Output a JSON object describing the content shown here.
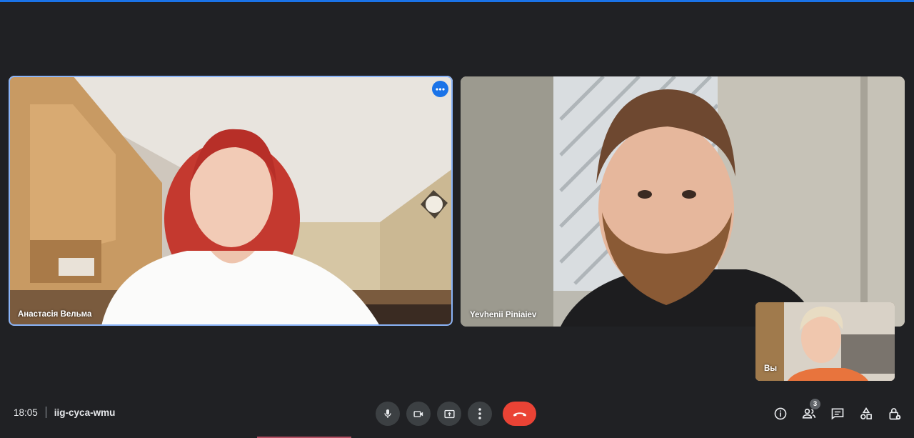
{
  "meeting": {
    "time": "18:05",
    "code": "iig-cyca-wmu"
  },
  "participants": [
    {
      "name": "Анастасія Вельма"
    },
    {
      "name": "Yevhenii Piniaiev"
    }
  ],
  "self": {
    "name": "Вы"
  },
  "people_count": "3",
  "icons": {
    "more": "more-vert-icon",
    "mic": "microphone-icon",
    "camera": "camera-icon",
    "present": "present-screen-icon",
    "options": "more-options-icon",
    "end": "end-call-icon",
    "info": "info-icon",
    "people": "people-icon",
    "chat": "chat-icon",
    "activities": "activities-icon",
    "host": "host-controls-icon"
  },
  "colors": {
    "background": "#202124",
    "active_border": "#8ab4f8",
    "end_call": "#ea4335",
    "accent": "#1a73e8"
  }
}
